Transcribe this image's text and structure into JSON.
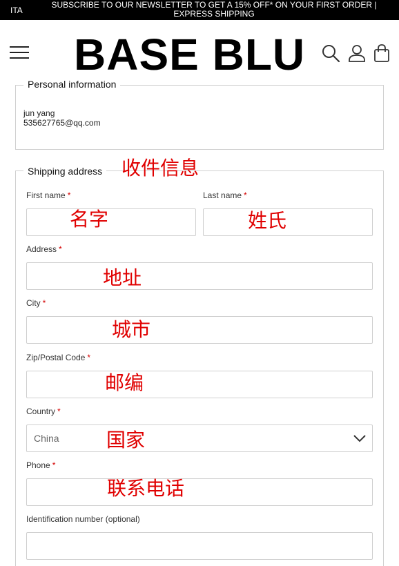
{
  "top_bar": {
    "language": "ITA",
    "promo_line1": "SUBSCRIBE TO OUR NEWSLETTER TO GET A 15% OFF* ON YOUR FIRST ORDER |",
    "promo_line2": "EXPRESS SHIPPING"
  },
  "header": {
    "logo": "BASE BLU",
    "icons": [
      "menu-icon",
      "search-icon",
      "account-icon",
      "bag-icon"
    ]
  },
  "personal_info": {
    "legend": "Personal information",
    "name": "jun yang",
    "email": "535627765@qq.com"
  },
  "shipping": {
    "legend": "Shipping address",
    "required_mark": "*",
    "first_name_label": "First name",
    "last_name_label": "Last name",
    "address_label": "Address",
    "city_label": "City",
    "zip_label": "Zip/Postal Code",
    "country_label": "Country",
    "country_value": "China",
    "phone_label": "Phone",
    "id_label": "Identification number (optional)"
  },
  "annotations": {
    "shipping_info": "收件信息",
    "first_name": "名字",
    "last_name": "姓氏",
    "address": "地址",
    "city": "城市",
    "zip": "邮编",
    "country": "国家",
    "phone": "联系电话"
  },
  "colors": {
    "top_bar_bg": "#000000",
    "required": "#d40000",
    "annotation": "#e00000",
    "border": "#cfcfcf"
  }
}
